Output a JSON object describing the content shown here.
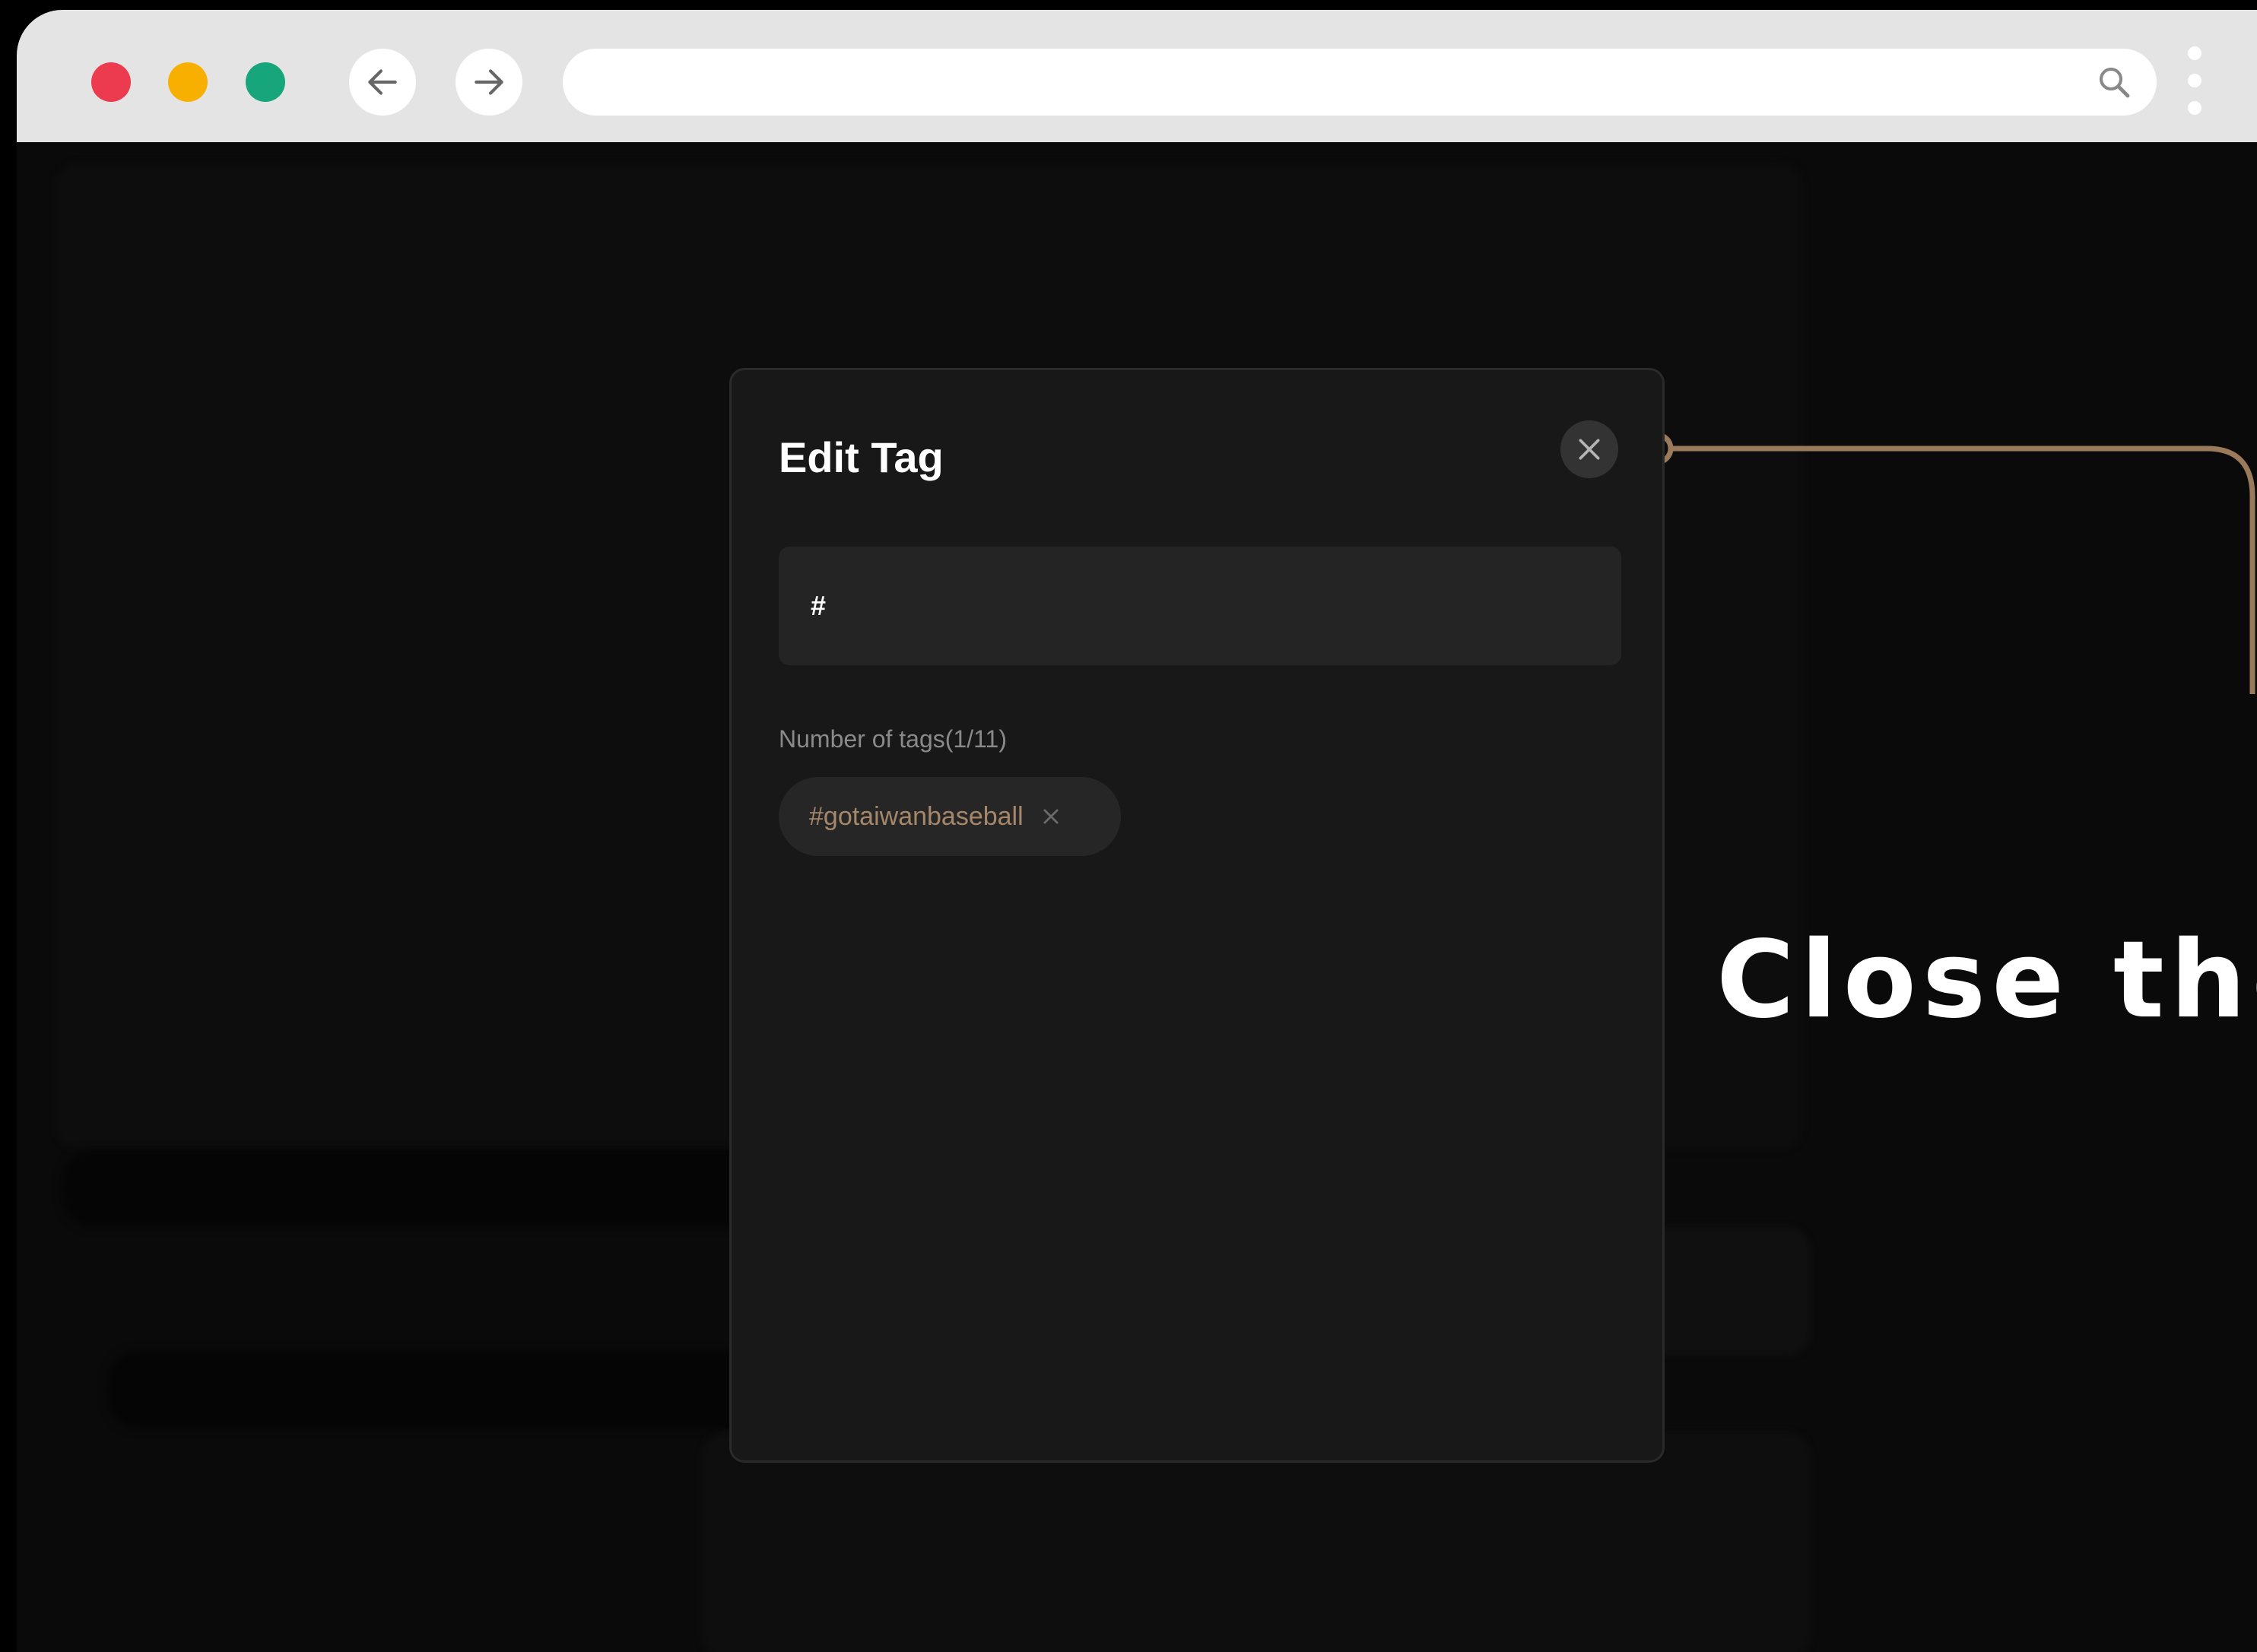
{
  "browser": {
    "url": "",
    "buttons": [
      "back",
      "forward"
    ],
    "icons": {
      "search": "search-icon",
      "menu": "vertical-dots-icon"
    },
    "traffic_lights": {
      "close": "#ec3a4e",
      "minimize": "#f8b000",
      "maximize": "#17a57b"
    }
  },
  "modal": {
    "title": "Edit Tag",
    "input_value": "#",
    "tag_count_label": "Number of tags(1/11)",
    "tags": [
      {
        "label": "#gotaiwanbaseball"
      }
    ],
    "close_icon": "close-icon"
  },
  "annotation": {
    "caption": "Close the",
    "connector_color": "#9a7a5b"
  }
}
